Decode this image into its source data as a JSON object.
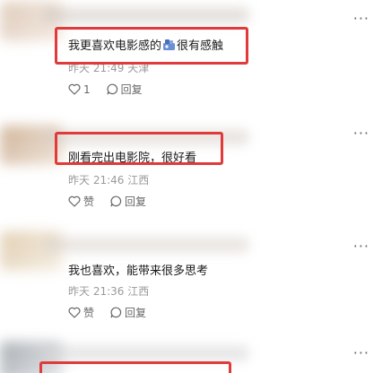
{
  "comments": [
    {
      "text_before_emoji": "我更喜欢电影感的",
      "emoji": "movie-camera-emoji",
      "text_after_emoji": "很有感触",
      "time": "昨天 21:49",
      "location": "天津",
      "like_label": "1",
      "reply_label": "回复",
      "more_label": "···"
    },
    {
      "text": "刚看完出电影院，很好看",
      "time": "昨天 21:46",
      "location": "江西",
      "like_label": "赞",
      "reply_label": "回复",
      "more_label": "···"
    },
    {
      "text": "我也喜欢，能带来很多思考",
      "time": "昨天 21:36",
      "location": "江西",
      "like_label": "赞",
      "reply_label": "回复",
      "more_label": "···"
    },
    {
      "more_label": "···"
    }
  ],
  "colors": {
    "highlight": "#e03a3a",
    "meta_text": "#9a9a9a",
    "action_text": "#666666"
  },
  "icons": {
    "like": "heart-outline-icon",
    "reply": "speech-bubble-icon",
    "more": "ellipsis-icon"
  }
}
